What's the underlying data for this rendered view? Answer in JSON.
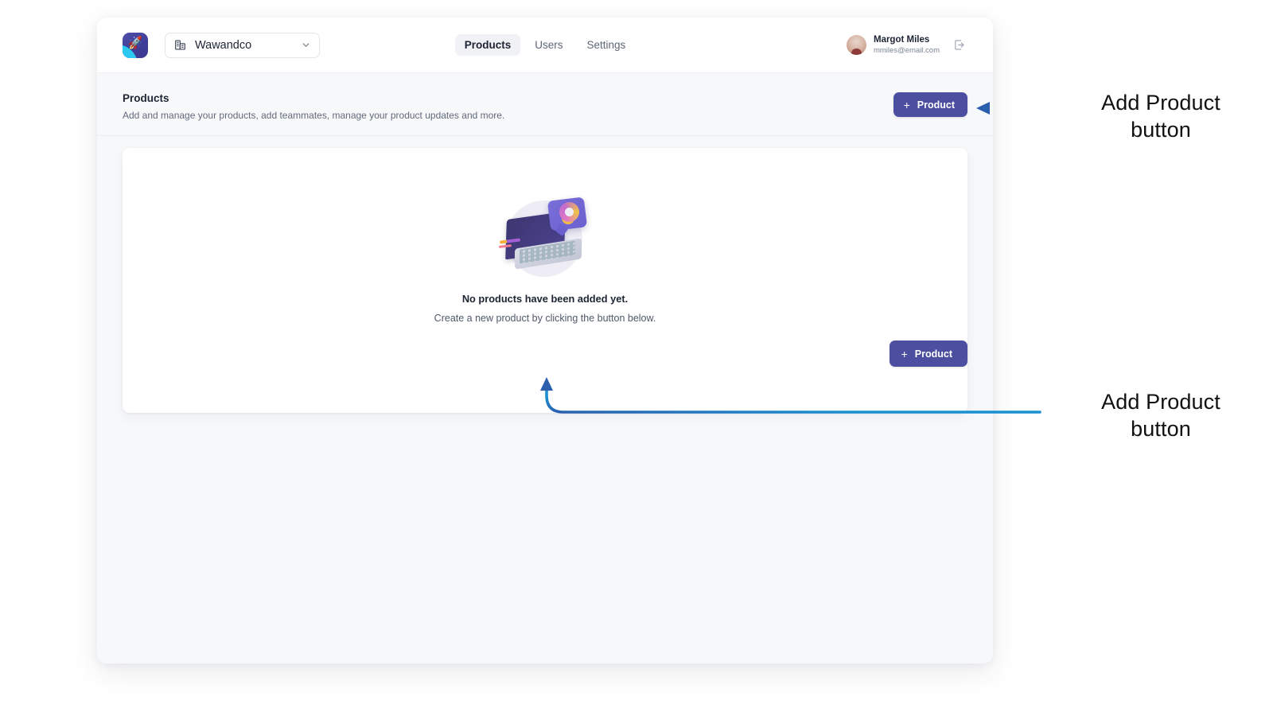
{
  "app": {
    "logo_icon": "rocket-icon",
    "org_selector": {
      "icon": "building-icon",
      "value": "Wawandco",
      "chevron_icon": "chevron-down-icon"
    }
  },
  "nav": {
    "items": [
      {
        "label": "Products",
        "active": true
      },
      {
        "label": "Users",
        "active": false
      },
      {
        "label": "Settings",
        "active": false
      }
    ]
  },
  "user": {
    "name": "Margot Miles",
    "email": "mmiles@email.com",
    "avatar_icon": "avatar",
    "logout_icon": "logout-icon"
  },
  "page": {
    "title": "Products",
    "subtitle": "Add and manage your products, add teammates, manage your product updates and more.",
    "primary_button": {
      "label": "Product",
      "plus_icon": "plus-icon"
    }
  },
  "empty_state": {
    "illustration": "laptop-illustration",
    "title": "No products have been added yet.",
    "subtitle": "Create a new product by clicking the button below.",
    "button": {
      "label": "Product",
      "plus_icon": "plus-icon"
    }
  },
  "annotations": {
    "top": {
      "text": "Add Product\nbutton",
      "arrow_icon": "arrow-left-icon"
    },
    "bottom": {
      "text": "Add Product\nbutton",
      "arrow_icon": "arrow-curve-up-icon"
    }
  },
  "colors": {
    "accent_button": "#4c4fa0",
    "annotation_arrow": "#1a8fd1",
    "annotation_arrow_dark": "#2b5fae",
    "page_background": "#f7f8fa",
    "logo_cyan": "#2bc8ef"
  }
}
